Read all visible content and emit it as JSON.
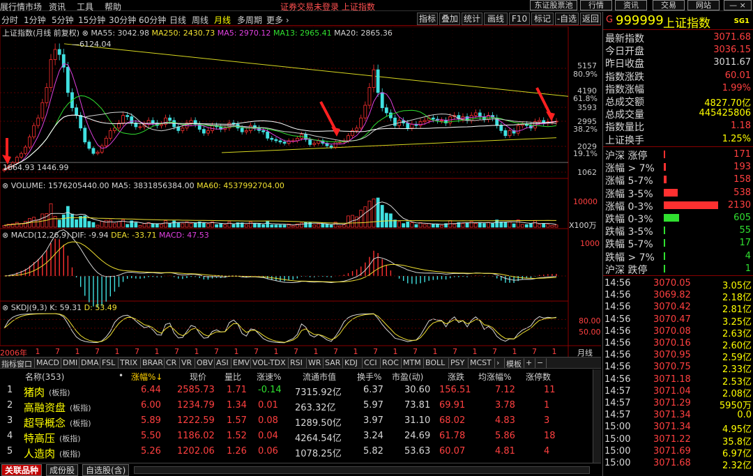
{
  "app": {
    "menu": [
      "展行情市场",
      "资讯",
      "工具",
      "帮助"
    ],
    "notice": "证券交易未登录 上证指数",
    "buttons": [
      "东证股票池",
      "行情",
      "资讯",
      "交易",
      "网站"
    ]
  },
  "period_tabs": [
    "分时",
    "1分钟",
    "5分钟",
    "15分钟",
    "30分钟",
    "60分钟",
    "日线",
    "周线",
    "月线",
    "多周期",
    "更多 ›"
  ],
  "period_active": "月线",
  "toolbar": [
    "指标",
    "叠加",
    "统计",
    "画线",
    "F10",
    "标记",
    "-自选",
    "返回"
  ],
  "chart": {
    "title": "上证指数(月线 前复权)",
    "ma": [
      {
        "label": "MA55: 3042.98",
        "color": "#d0d0d0"
      },
      {
        "label": "MA250: 2430.73",
        "color": "#f0e030"
      },
      {
        "label": "MA5: 2970.12",
        "color": "#e040e0"
      },
      {
        "label": "MA13: 2965.41",
        "color": "#30e030"
      },
      {
        "label": "MA20: 2865.36",
        "color": "#d0d0d0"
      }
    ],
    "high_note": "6124.04",
    "low_note": "1664.93 1446.99",
    "x_labels": [
      "2006年",
      "1",
      "7",
      "1",
      "7",
      "1",
      "7",
      "1",
      "7",
      "1",
      "7",
      "1",
      "7",
      "1",
      "7",
      "1",
      "7",
      "1",
      "7",
      "1",
      "7",
      "1",
      "7",
      "1",
      "7",
      "1",
      "7",
      "1"
    ],
    "price_axis": [
      {
        "v": "5157",
        "c": "#ff4040"
      },
      {
        "v": "80.9%",
        "c": "#ff4040"
      },
      {
        "v": "4190",
        "c": "#ff4040"
      },
      {
        "v": "61.8%",
        "c": "#ff4040"
      },
      {
        "v": "3593",
        "c": "#ff4040"
      },
      {
        "v": "2995",
        "c": "#ff4040"
      },
      {
        "v": "38.2%",
        "c": "#ff4040"
      },
      {
        "v": "2029",
        "c": "#ff4040"
      },
      {
        "v": "19.1%",
        "c": "#ff4040"
      },
      {
        "v": "1062",
        "c": "#ff4040"
      }
    ],
    "volume": {
      "title": "VOLUME: 1576205440.00",
      "ma5": "MA5: 3831856384.00",
      "ma60": "MA60: 4537992704.00",
      "axis": "10000",
      "unit": "X100万"
    },
    "macd": {
      "title": "MACD(12,26,9)",
      "dif": "DIF: -9.94",
      "dea": "DEA: -33.71",
      "macd": "MACD: 47.53",
      "axis": "1000"
    },
    "skdj": {
      "title": "SKDJ(9,3)",
      "k": "K: 59.31",
      "d": "D: 53.49",
      "axis1": "80.00",
      "axis2": "50.00"
    },
    "period_label": "月线"
  },
  "chart_data": {
    "type": "candlestick",
    "title": "上证指数(月线 前复权)",
    "high": 6124.04,
    "low": 1664.93,
    "y_ticks": [
      5157,
      4190,
      3593,
      2995,
      2029,
      1062
    ],
    "close": [
      1180,
      1300,
      1440,
      1650,
      1800,
      2050,
      2450,
      2900,
      3200,
      3800,
      4400,
      5500,
      5900,
      5700,
      5200,
      4200,
      3600,
      3300,
      2800,
      2250,
      2000,
      1800,
      1850,
      2100,
      2400,
      2700,
      2800,
      3000,
      3300,
      3250,
      3000,
      2850,
      2850,
      2950,
      3100,
      3000,
      2900,
      2950,
      3200,
      3100,
      2850,
      2700,
      2800,
      3000,
      3100,
      2950,
      2750,
      2600,
      2700,
      2900,
      2850,
      2750,
      2800,
      3000,
      2950,
      2800,
      2650,
      2700,
      2900,
      2800,
      2700,
      2650,
      2400,
      2350,
      2300,
      2250,
      2200,
      2300,
      2300,
      2400,
      2550,
      2350,
      2150,
      2200,
      2300,
      2200,
      2100,
      2050,
      2250,
      2250,
      2300,
      2500,
      2700,
      2800,
      3200,
      3700,
      4400,
      5100,
      4200,
      3600,
      3400,
      3200,
      2900,
      3100,
      3000,
      2800,
      2950,
      2900,
      3050,
      3100,
      3200,
      3150,
      3100,
      3100,
      3000,
      3250,
      3300,
      3150,
      3250,
      3100,
      3300,
      3400,
      3250,
      3150,
      3300,
      3200,
      2900,
      2700,
      2500,
      2700,
      2600,
      2900,
      2950,
      2900,
      2800,
      3050,
      3100,
      3000,
      3050,
      3050,
      3070
    ]
  },
  "info": {
    "code": "999999",
    "name": "上证指数",
    "tag": "SG1",
    "rows": [
      {
        "k": "最新指数",
        "v": "3071.68",
        "c": "#ff4040"
      },
      {
        "k": "今日开盘",
        "v": "3036.15",
        "c": "#ff4040"
      },
      {
        "k": "昨日收盘",
        "v": "3011.67",
        "c": "#d8d8d8"
      },
      {
        "k": "指数涨跌",
        "v": "60.01",
        "c": "#ff4040"
      },
      {
        "k": "指数涨幅",
        "v": "1.99%",
        "c": "#ff4040"
      },
      {
        "k": "总成交额",
        "v": "4827.70亿",
        "c": "#ffff00"
      },
      {
        "k": "总成交量",
        "v": "445425806",
        "c": "#ffff00"
      },
      {
        "k": "指数量比",
        "v": "1.18",
        "c": "#ff4040"
      },
      {
        "k": "上证换手",
        "v": "1.25%",
        "c": "#ffff00"
      }
    ]
  },
  "breadth": [
    {
      "k": "沪深 涨停",
      "v": "171",
      "frac": 0.02,
      "c": "#ff3030"
    },
    {
      "k": "涨幅 > 7%",
      "v": "193",
      "frac": 0.04,
      "c": "#ff3030"
    },
    {
      "k": "涨幅 5-7%",
      "v": "158",
      "frac": 0.05,
      "c": "#ff3030"
    },
    {
      "k": "涨幅 3-5%",
      "v": "538",
      "frac": 0.25,
      "c": "#ff3030"
    },
    {
      "k": "涨幅 0-3%",
      "v": "2130",
      "frac": 1.0,
      "c": "#ff3030"
    },
    {
      "k": "跌幅 0-3%",
      "v": "605",
      "frac": 0.28,
      "c": "#30e030"
    },
    {
      "k": "跌幅 3-5%",
      "v": "55",
      "frac": 0.03,
      "c": "#30e030"
    },
    {
      "k": "跌幅 5-7%",
      "v": "17",
      "frac": 0.01,
      "c": "#30e030"
    },
    {
      "k": "跌幅 > 7%",
      "v": "4",
      "frac": 0.005,
      "c": "#30e030"
    },
    {
      "k": "沪深 跌停",
      "v": "1",
      "frac": 0.003,
      "c": "#30e030"
    }
  ],
  "ticks": [
    {
      "t": "14:56",
      "p": "3070.05",
      "a": "3.05亿"
    },
    {
      "t": "14:56",
      "p": "3069.82",
      "a": "2.18亿"
    },
    {
      "t": "14:56",
      "p": "3070.42",
      "a": "2.81亿"
    },
    {
      "t": "14:56",
      "p": "3070.47",
      "a": "3.25亿"
    },
    {
      "t": "14:56",
      "p": "3070.08",
      "a": "2.63亿"
    },
    {
      "t": "14:56",
      "p": "3070.16",
      "a": "2.60亿"
    },
    {
      "t": "14:56",
      "p": "3070.95",
      "a": "2.59亿"
    },
    {
      "t": "14:56",
      "p": "3070.75",
      "a": "2.33亿"
    },
    {
      "t": "14:56",
      "p": "3071.18",
      "a": "2.53亿"
    },
    {
      "t": "14:57",
      "p": "3071.04",
      "a": "2.08亿"
    },
    {
      "t": "14:57",
      "p": "3071.29",
      "a": "5950万"
    },
    {
      "t": "14:57",
      "p": "3071.34",
      "a": "0.0"
    },
    {
      "t": "15:00",
      "p": "3071.34",
      "a": "4.95亿"
    },
    {
      "t": "15:00",
      "p": "3071.22",
      "a": "35.8亿"
    },
    {
      "t": "15:00",
      "p": "3071.69",
      "a": "6.97亿"
    },
    {
      "t": "15:00",
      "p": "3071.68",
      "a": "2.32亿"
    }
  ],
  "indicator_tabs": [
    "指标",
    "窗口",
    "MACD",
    "DMI",
    "DMA",
    "FSL",
    "TRIX",
    "BRAR",
    "CR",
    "VR",
    "OBV",
    "ASI",
    "EMV",
    "VOL-TDX",
    "RSI",
    "WR",
    "SAR",
    "KDJ",
    "CCI",
    "ROC",
    "MTM",
    "BOLL",
    "PSY",
    "MCST",
    "›",
    "模板",
    "+",
    "−"
  ],
  "table": {
    "headers": [
      "名称(353)",
      "•",
      "涨幅%↓",
      "现价",
      "量比",
      "涨速%",
      "流通市值",
      "换手%",
      "市盈(动)",
      "涨跌",
      "均涨幅%",
      "涨停数"
    ],
    "rows": [
      {
        "n": "1",
        "name": "猪肉",
        "sub": "(板指)",
        "chg": "6.44",
        "price": "2585.73",
        "vr": "1.71",
        "spd": "-0.14",
        "cap": "7315.92亿",
        "turn": "6.37",
        "pe": "30.60",
        "diff": "156.51",
        "avg": "7.12",
        "lim": "11"
      },
      {
        "n": "2",
        "name": "高融资盘",
        "sub": "(板指)",
        "chg": "6.00",
        "price": "1234.79",
        "vr": "1.34",
        "spd": "0.01",
        "cap": "263.32亿",
        "turn": "5.97",
        "pe": "73.81",
        "diff": "69.91",
        "avg": "3.78",
        "lim": "1"
      },
      {
        "n": "3",
        "name": "超导概念",
        "sub": "(板指)",
        "chg": "5.89",
        "price": "1222.59",
        "vr": "1.57",
        "spd": "0.08",
        "cap": "1289.50亿",
        "turn": "3.97",
        "pe": "31.10",
        "diff": "68.02",
        "avg": "4.83",
        "lim": "3"
      },
      {
        "n": "4",
        "name": "特高压",
        "sub": "(板指)",
        "chg": "5.50",
        "price": "1186.02",
        "vr": "1.52",
        "spd": "0.04",
        "cap": "4264.54亿",
        "turn": "3.24",
        "pe": "24.69",
        "diff": "61.78",
        "avg": "5.86",
        "lim": "18"
      },
      {
        "n": "5",
        "name": "人造肉",
        "sub": "(板指)",
        "chg": "5.26",
        "price": "1202.06",
        "vr": "1.26",
        "spd": "0.06",
        "cap": "1078.25亿",
        "turn": "5.82",
        "pe": "53.63",
        "diff": "60.07",
        "avg": "4.81",
        "lim": "4"
      }
    ]
  },
  "bottom_tabs": [
    "关联品种",
    "成份股",
    "自选股(含)"
  ]
}
